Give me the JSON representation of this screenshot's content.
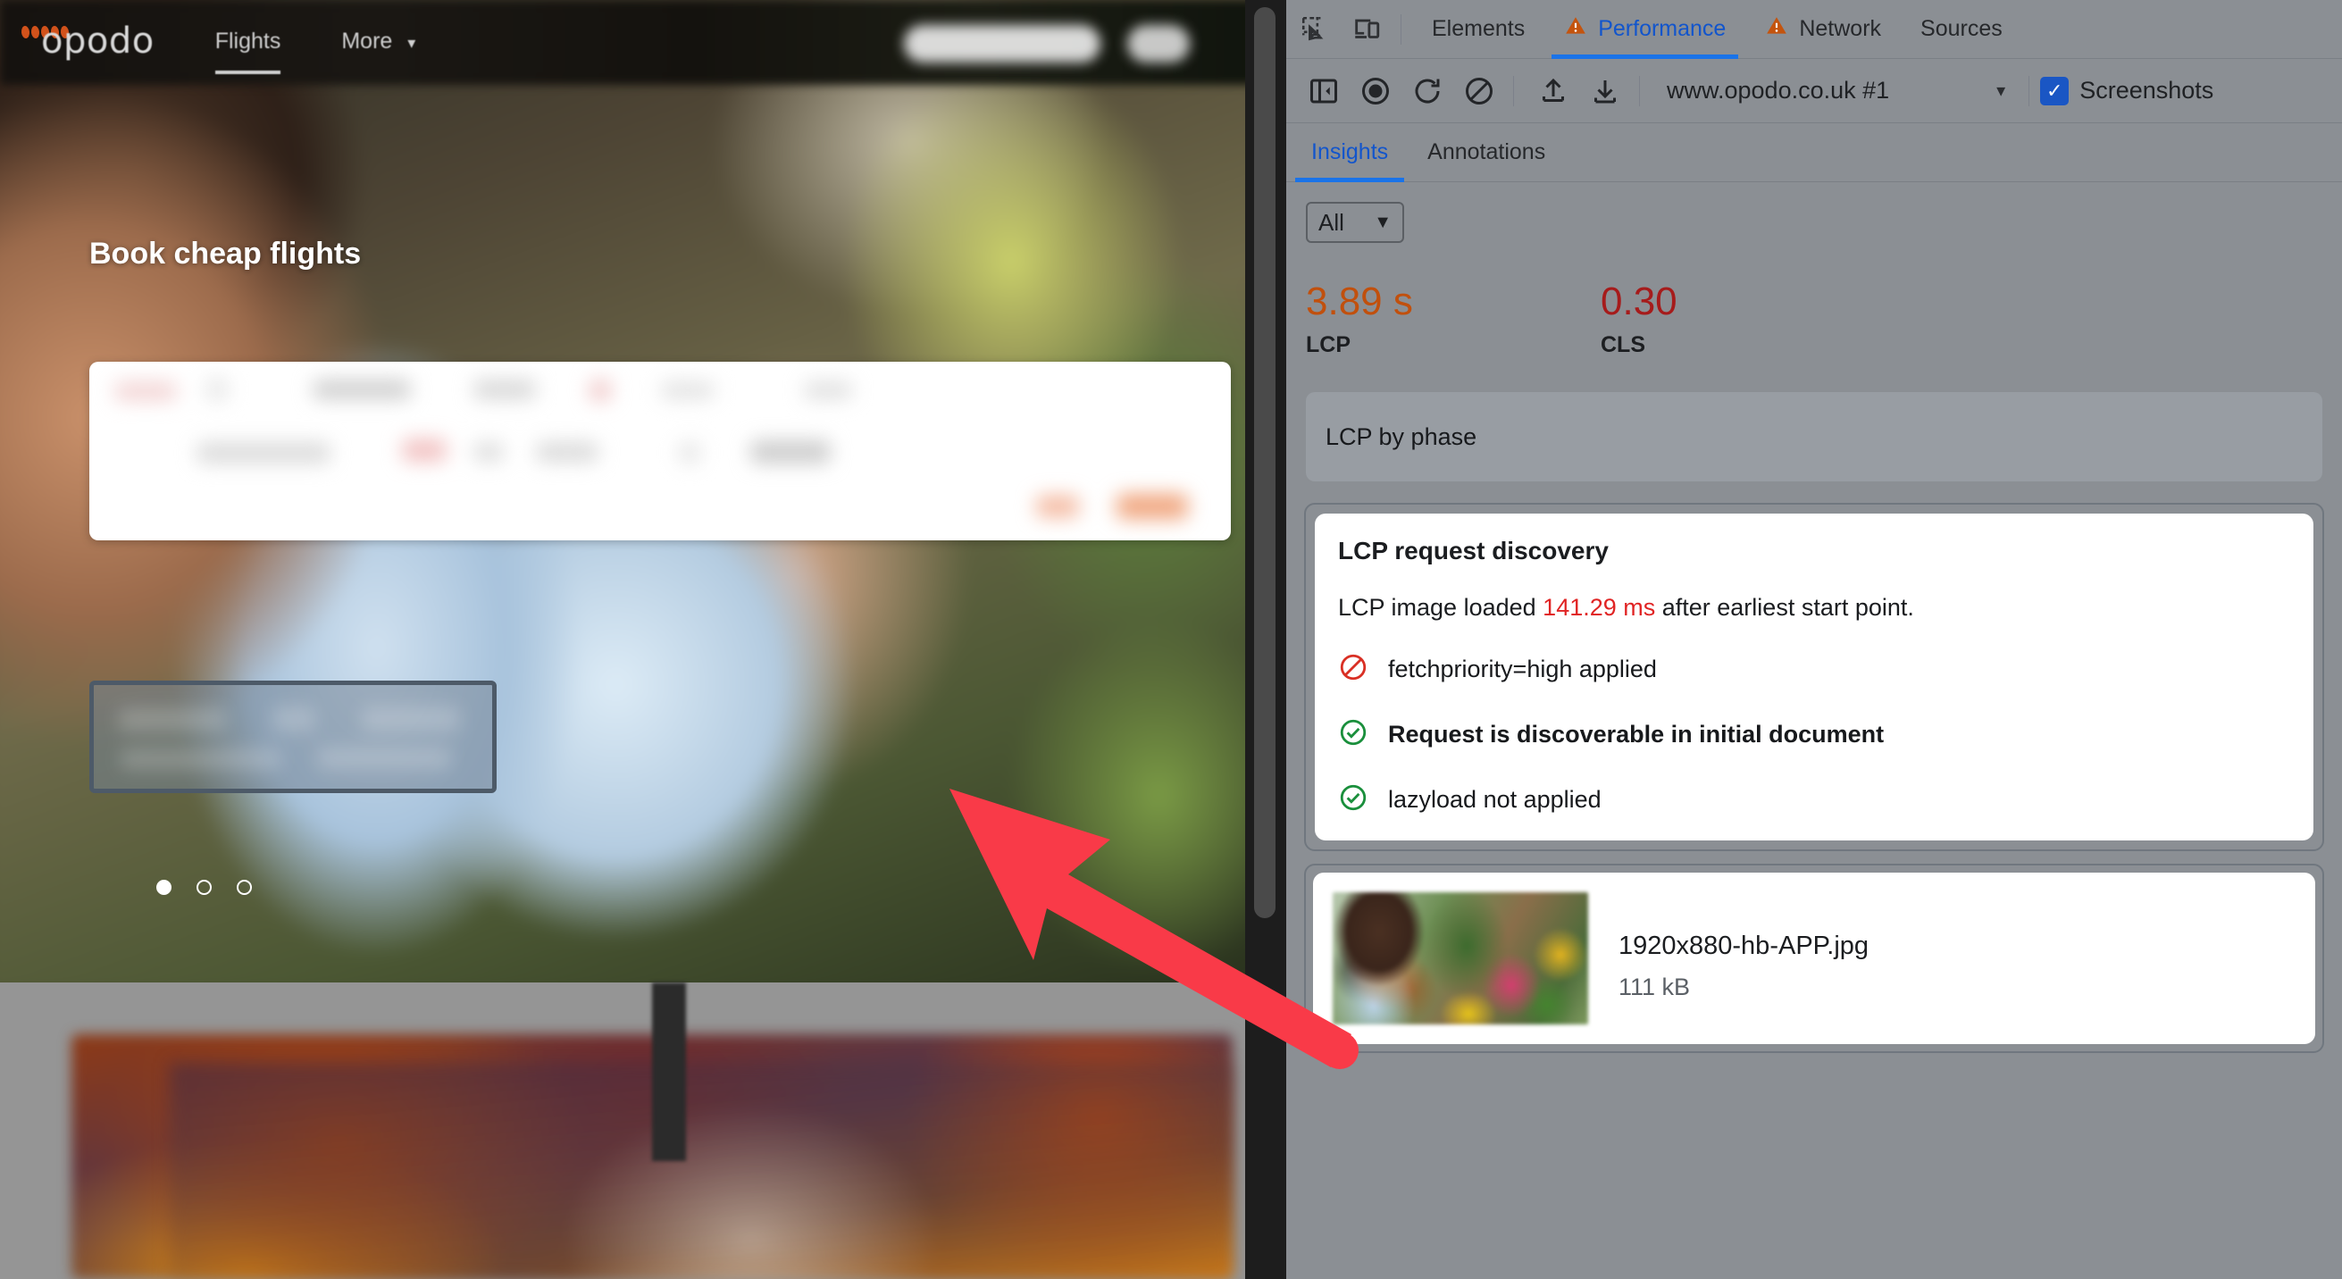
{
  "page": {
    "brand": "opodo",
    "nav": [
      {
        "label": "Flights",
        "active": true
      },
      {
        "label": "More",
        "active": false,
        "caret": "chevron-down-icon"
      }
    ],
    "hero_title": "Book cheap flights",
    "carousel": {
      "count": 3,
      "active_index": 0
    }
  },
  "devtools": {
    "left_icons": [
      {
        "name": "inspect-element-icon"
      },
      {
        "name": "device-toolbar-icon"
      }
    ],
    "tabs": [
      {
        "label": "Elements",
        "active": false,
        "warning": false
      },
      {
        "label": "Performance",
        "active": true,
        "warning": true
      },
      {
        "label": "Network",
        "active": false,
        "warning": true
      },
      {
        "label": "Sources",
        "active": false,
        "warning": false
      }
    ],
    "toolbar": {
      "icons": [
        {
          "name": "sidebar-toggle-icon"
        },
        {
          "name": "record-icon"
        },
        {
          "name": "reload-and-record-icon"
        },
        {
          "name": "clear-icon"
        },
        {
          "name": "upload-icon"
        },
        {
          "name": "download-icon"
        }
      ],
      "recording_label": "www.opodo.co.uk #1",
      "recording_caret": "chevron-down-icon",
      "screenshots_label": "Screenshots",
      "screenshots_checked": true
    },
    "subtabs": [
      {
        "label": "Insights",
        "active": true
      },
      {
        "label": "Annotations",
        "active": false
      }
    ],
    "filter": {
      "value": "All",
      "caret": "chevron-down-icon"
    },
    "metrics": [
      {
        "value": "3.89 s",
        "label": "LCP",
        "color": "#c1500d"
      },
      {
        "value": "0.30",
        "label": "CLS",
        "color": "#a61b1b"
      }
    ],
    "phase_card_title": "LCP by phase",
    "insight": {
      "title": "LCP request discovery",
      "summary_prefix": "LCP image loaded ",
      "summary_highlight": "141.29 ms",
      "summary_suffix": " after earliest start point.",
      "checks": [
        {
          "label": "fetchpriority=high applied",
          "status": "fail",
          "icon": "no-entry-icon",
          "color": "#d93025"
        },
        {
          "label": "Request is discoverable in initial document",
          "status": "pass",
          "icon": "check-circle-icon",
          "color": "#1a8f3c"
        },
        {
          "label": "lazyload not applied",
          "status": "pass",
          "icon": "check-circle-icon",
          "color": "#1a8f3c"
        }
      ]
    },
    "image_result": {
      "thumbnail_alt": "lcp-image-thumbnail",
      "name": "1920x880-hb-APP.jpg",
      "size": "111 kB"
    }
  },
  "annotation": {
    "arrow": {
      "name": "red-arrow-annotation",
      "color": "#f93a48"
    }
  }
}
